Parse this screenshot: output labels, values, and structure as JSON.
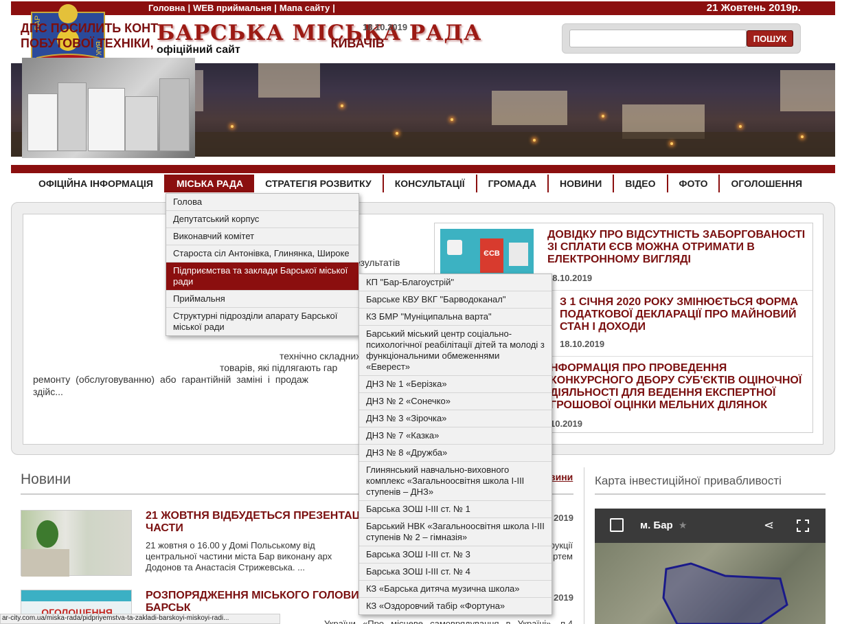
{
  "topbar": {
    "links": [
      "Головна",
      "WEB приймальня",
      "Мапа сайту"
    ],
    "date": "21 Жовтень 2019р."
  },
  "header": {
    "title": "БАРСЬКА МІСЬКА РАДА",
    "subtitle": "офіційний сайт",
    "crest_text_left": "БАР",
    "crest_text_right": "ВАК"
  },
  "search": {
    "placeholder": "",
    "button": "ПОШУК"
  },
  "nav": {
    "items": [
      "ОФІЦІЙНА ІНФОРМАЦІЯ",
      "МІСЬКА РАДА",
      "СТРАТЕГІЯ РОЗВИТКУ",
      "КОНСУЛЬТАЦІЇ",
      "ГРОМАДА",
      "НОВИНИ",
      "ВІДЕО",
      "ФОТО",
      "ОГОЛОШЕННЯ"
    ],
    "active": "МІСЬКА РАДА"
  },
  "menu": {
    "items": [
      "Голова",
      "Депутатський корпус",
      "Виконавчий комітет",
      "Староста сіл Антонівка, Глинянка, Широке",
      "Підприємства та заклади Барської міської ради",
      "Приймальня",
      "Структурні підрозділи апарату Барської міської ради"
    ],
    "submenu": [
      "КП \"Бар-Благоустрій\"",
      "Барське КВУ ВКГ \"Барводоканал\"",
      "КЗ БМР \"Муніципальна варта\"",
      "Барський міський центр соціально-психологічної реабілітації дітей та молоді з функціональними обмеженнями «Еверест»",
      "ДНЗ № 1 «Берізка»",
      "ДНЗ № 2 «Сонечко»",
      "ДНЗ № 3 «Зірочка»",
      "ДНЗ № 7 «Казка»",
      "ДНЗ № 8 «Дружба»",
      "Глинянський навчально-виховного комплекс «Загальноосвітня школа І-ІІІ ступенів – ДНЗ»",
      "Барська ЗОШ І-ІІІ ст. № 1",
      "Барський НВК «Загальноосвітня школа І-ІІІ ступенів № 2 – гімназія»",
      "Барська ЗОШ І-ІІІ ст. № 3",
      "Барська ЗОШ І-ІІІ ст. № 4",
      "КЗ «Барська дитяча музична школа»",
      "КЗ «Оздоровчий табір «Фортуна»"
    ]
  },
  "lead": {
    "title_a": "ДПС ПОСИЛИТЬ КОНТ",
    "title_b": "ПОБУТОВОЇ ТЕХНІКИ,",
    "title_c": "КИВАЧІВ",
    "date": "18.10.2019",
    "frag1": "езультатів",
    "frag2": "технічно складних",
    "frag3": "товарів, які підлягають гар",
    "frag4": "ремонту (обслуговуванню) або гарантійній заміні і продаж",
    "frag5": "здійс..."
  },
  "side": [
    {
      "title": "ДОВІДКУ ПРО ВІДСУТНІСТЬ ЗАБОРГОВАНОСТІ ЗІ СПЛАТИ ЄСВ МОЖНА ОТРИМАТИ В ЕЛЕКТРОННОМУ ВИГЛЯДІ",
      "date": "18.10.2019",
      "thumb_label": "ЄСВ"
    },
    {
      "title": "З 1 СІЧНЯ 2020 РОКУ ЗМІНЮЄТЬСЯ ФОРМА ПОДАТКОВОЇ ДЕКЛАРАЦІЇ ПРО МАЙНОВИЙ СТАН І ДОХОДИ",
      "date": "18.10.2019"
    },
    {
      "title": "НФОРМАЦІЯ ПРО ПРОВЕДЕННЯ КОНКУРСНОГО ДБОРУ СУБ'ЄКТІВ ОЦІНОЧНОЇ ДІЯЛЬНОСТІ ДЛЯ ВЕДЕННЯ ЕКСПЕРТНОЇ ГРОШОВОЇ ОЦІНКИ МЕЛЬНИХ ДІЛЯНОК",
      "date": "10.2019"
    }
  ],
  "news": {
    "heading": "Новини",
    "all_link": "вини",
    "items": [
      {
        "title": "21 ЖОВТНЯ ВІДБУДЕТЬСЯ ПРЕЗЕНТАЦ РЕКОНСТРУКЦІЇ ЦЕНТРАЛЬНОЇ ЧАСТИ",
        "date": "2019",
        "body_a": "21 жовтня о 16.00 у Домі Польському від",
        "body_a_end": "рукції",
        "body_b": "центральної частини міста Бар виконану арх",
        "body_b_end": "ртем",
        "body_c": "Додонов та Анастасія Стрижевська. ..."
      },
      {
        "title": "РОЗПОРЯДЖЕННЯ МІСЬКОГО ГОЛОВИ «ПРО ПЕРЕНЕСЕННЯ 45 СЕСІЇ БАРСЬК",
        "date": "2019",
        "thumb_label": "ОГОЛОШЕННЯ",
        "body_a": "України «Про місцеве самоврядування в Україні», п.4 ст.3,3.4"
      }
    ]
  },
  "map": {
    "heading": "Карта інвестиційної привабливості",
    "title": "м. Бар"
  },
  "status_url": "ar-city.com.ua/miska-rada/pidpriyemstva-ta-zakladi-barskoyi-miskoyi-radi...",
  "colors": {
    "brand": "#8b0f0f",
    "title_red": "#9c1a14"
  }
}
